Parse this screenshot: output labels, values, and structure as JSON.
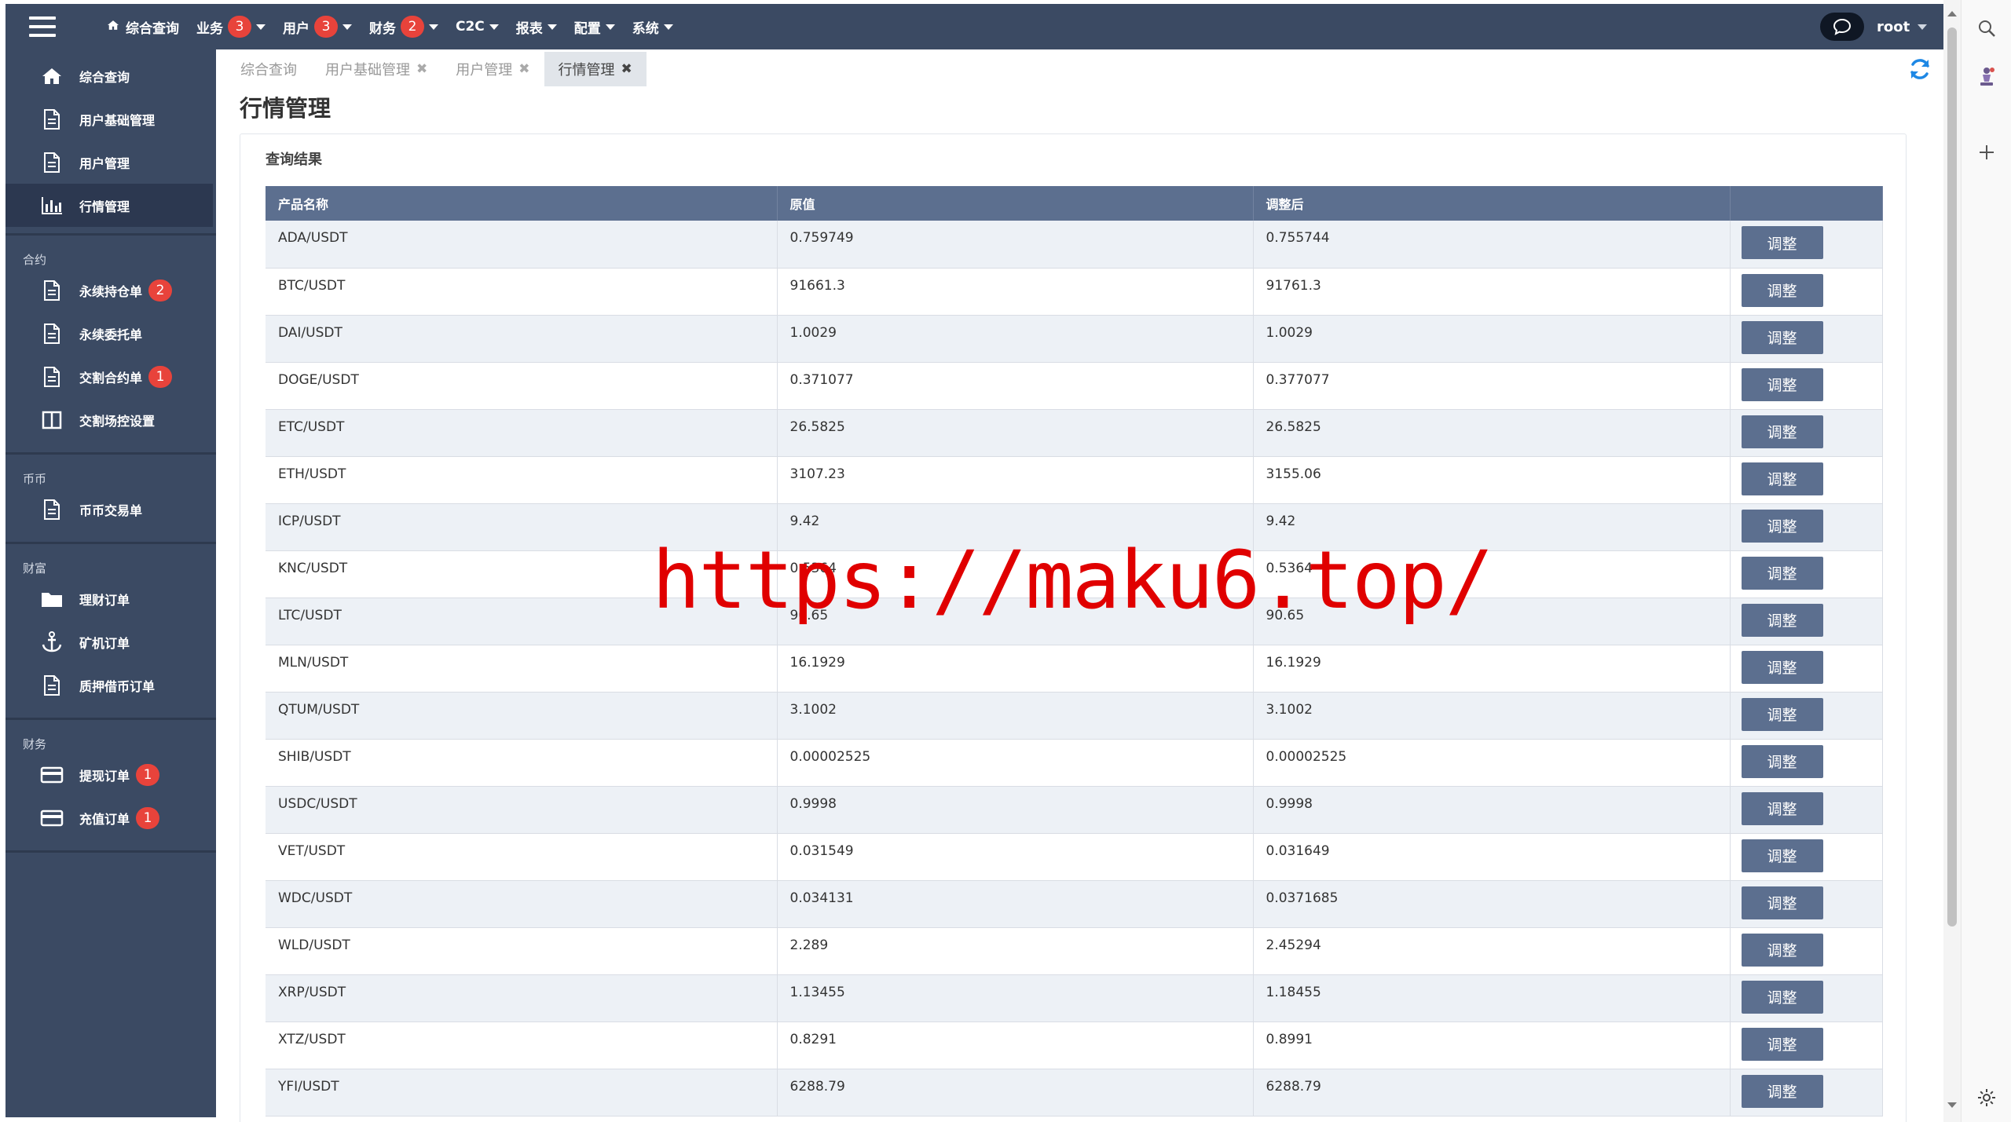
{
  "topnav": {
    "menu": [
      {
        "label": "综合查询",
        "icon": "home-icon"
      },
      {
        "label": "业务",
        "badge": "3",
        "caret": true
      },
      {
        "label": "用户",
        "badge": "3",
        "caret": true
      },
      {
        "label": "财务",
        "badge": "2",
        "caret": true
      },
      {
        "label": "C2C",
        "caret": true
      },
      {
        "label": "报表",
        "caret": true
      },
      {
        "label": "配置",
        "caret": true
      },
      {
        "label": "系统",
        "caret": true
      }
    ],
    "user": "root"
  },
  "sidebar": {
    "top_items": [
      {
        "label": "综合查询",
        "icon": "home-icon"
      },
      {
        "label": "用户基础管理",
        "icon": "document-icon"
      },
      {
        "label": "用户管理",
        "icon": "document-icon"
      },
      {
        "label": "行情管理",
        "icon": "bar-chart-icon",
        "active": true
      }
    ],
    "groups": [
      {
        "title": "合约",
        "items": [
          {
            "label": "永续持仓单",
            "icon": "document-icon",
            "badge": "2"
          },
          {
            "label": "永续委托单",
            "icon": "document-icon"
          },
          {
            "label": "交割合约单",
            "icon": "document-icon",
            "badge": "1"
          },
          {
            "label": "交割场控设置",
            "icon": "columns-icon"
          }
        ]
      },
      {
        "title": "币币",
        "items": [
          {
            "label": "币币交易单",
            "icon": "document-icon"
          }
        ]
      },
      {
        "title": "财富",
        "items": [
          {
            "label": "理财订单",
            "icon": "folder-icon"
          },
          {
            "label": "矿机订单",
            "icon": "anchor-icon"
          },
          {
            "label": "质押借币订单",
            "icon": "document-icon"
          }
        ]
      },
      {
        "title": "财务",
        "items": [
          {
            "label": "提现订单",
            "icon": "credit-card-icon",
            "badge": "1"
          },
          {
            "label": "充值订单",
            "icon": "credit-card-icon",
            "badge": "1"
          }
        ]
      }
    ]
  },
  "tabs": [
    {
      "label": "综合查询",
      "closable": false
    },
    {
      "label": "用户基础管理",
      "closable": true
    },
    {
      "label": "用户管理",
      "closable": true
    },
    {
      "label": "行情管理",
      "closable": true,
      "active": true
    }
  ],
  "page_title": "行情管理",
  "panel_title": "查询结果",
  "table": {
    "columns": [
      "产品名称",
      "原值",
      "调整后",
      ""
    ],
    "action_label": "调整",
    "rows": [
      [
        "ADA/USDT",
        "0.759749",
        "0.755744"
      ],
      [
        "BTC/USDT",
        "91661.3",
        "91761.3"
      ],
      [
        "DAI/USDT",
        "1.0029",
        "1.0029"
      ],
      [
        "DOGE/USDT",
        "0.371077",
        "0.377077"
      ],
      [
        "ETC/USDT",
        "26.5825",
        "26.5825"
      ],
      [
        "ETH/USDT",
        "3107.23",
        "3155.06"
      ],
      [
        "ICP/USDT",
        "9.42",
        "9.42"
      ],
      [
        "KNC/USDT",
        "0.5364",
        "0.5364"
      ],
      [
        "LTC/USDT",
        "90.65",
        "90.65"
      ],
      [
        "MLN/USDT",
        "16.1929",
        "16.1929"
      ],
      [
        "QTUM/USDT",
        "3.1002",
        "3.1002"
      ],
      [
        "SHIB/USDT",
        "0.00002525",
        "0.00002525"
      ],
      [
        "USDC/USDT",
        "0.9998",
        "0.9998"
      ],
      [
        "VET/USDT",
        "0.031549",
        "0.031649"
      ],
      [
        "WDC/USDT",
        "0.034131",
        "0.0371685"
      ],
      [
        "WLD/USDT",
        "2.289",
        "2.45294"
      ],
      [
        "XRP/USDT",
        "1.13455",
        "1.18455"
      ],
      [
        "XTZ/USDT",
        "0.8291",
        "0.8991"
      ],
      [
        "YFI/USDT",
        "6288.79",
        "6288.79"
      ]
    ]
  },
  "watermark": "https://maku6.top/",
  "colors": {
    "nav_bg": "#3b4a63",
    "header_row": "#5c6f8f",
    "badge": "#e8433b",
    "row_alt": "#edf1f6",
    "refresh": "#1e88e5",
    "watermark": "#e00000"
  }
}
